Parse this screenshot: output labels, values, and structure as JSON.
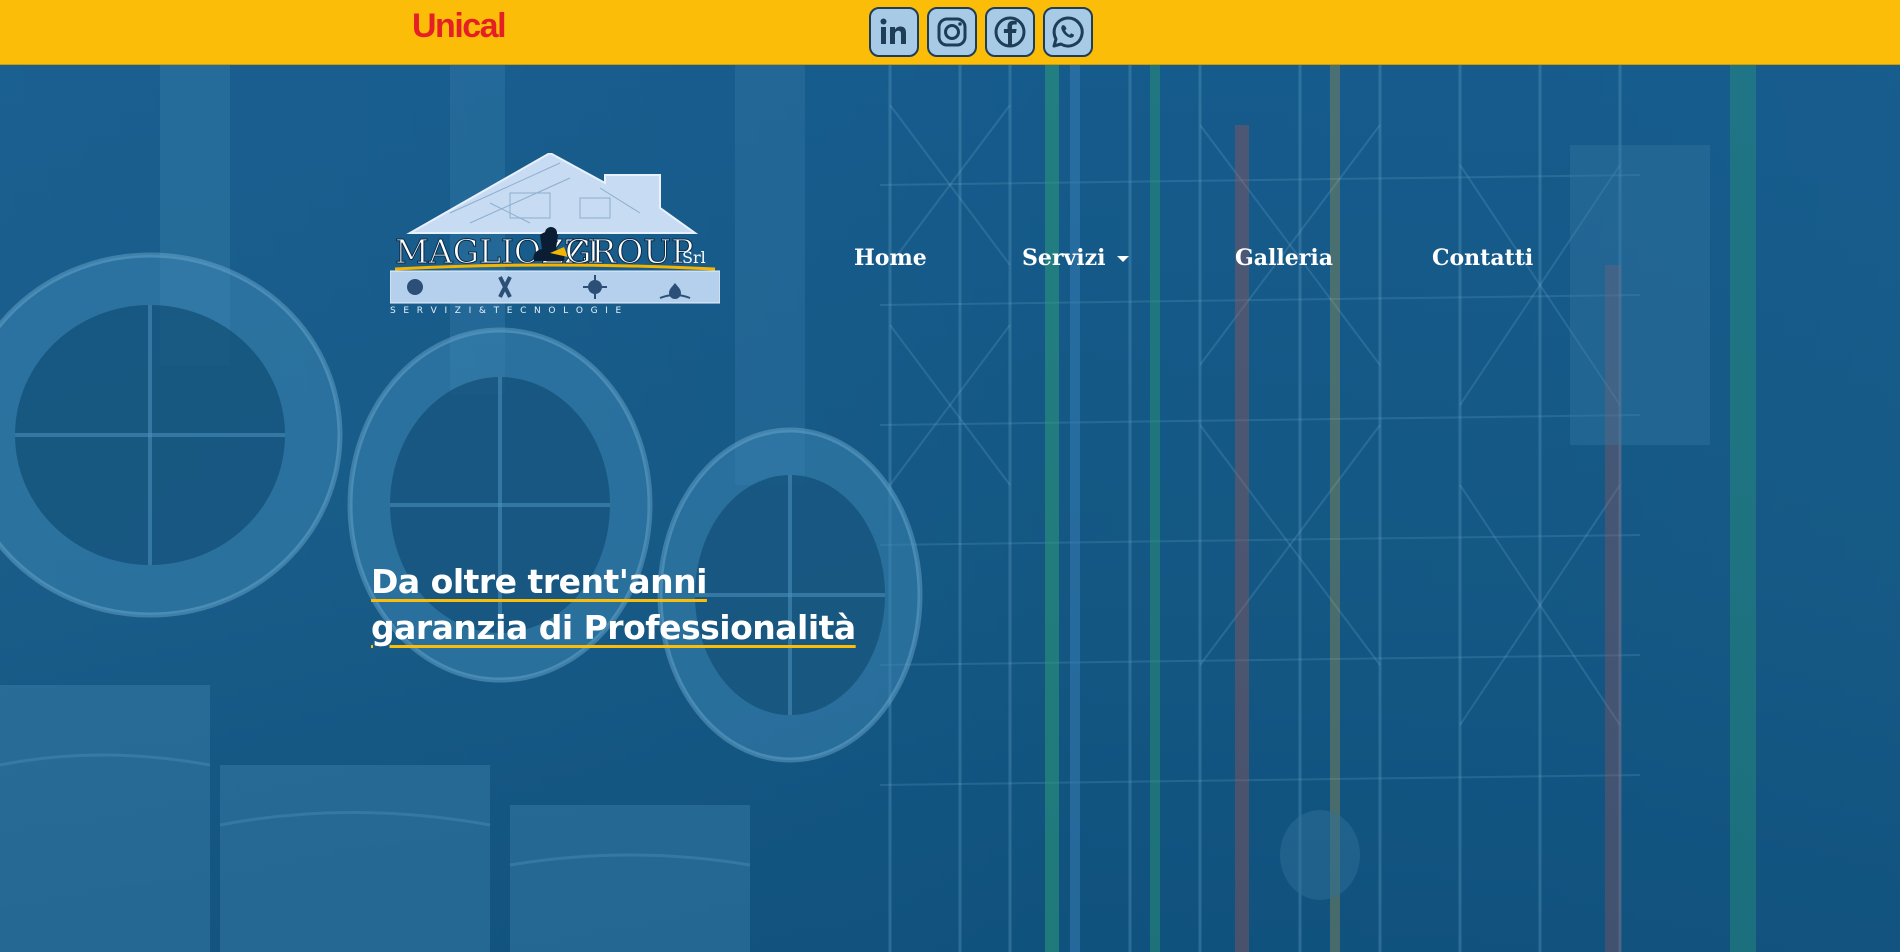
{
  "topbar": {
    "brand": "Unical",
    "social": [
      {
        "icon": "linkedin-icon",
        "label": "in"
      },
      {
        "icon": "instagram-icon"
      },
      {
        "icon": "facebook-icon"
      },
      {
        "icon": "whatsapp-icon"
      }
    ],
    "colors": {
      "bar": "#fbbd08",
      "brand": "#e42026",
      "icon_bg": "#a7cbe6"
    }
  },
  "logo": {
    "name_part1": "MAGLIOZZI",
    "name_part2": "GROUP",
    "suffix": "Srl",
    "tagline": "S E R V I Z I   &   T E C N O L O G I E"
  },
  "nav": {
    "home": "Home",
    "servizi": "Servizi",
    "galleria": "Galleria",
    "contatti": "Contatti"
  },
  "hero": {
    "line1": "Da oltre trent'anni",
    "line2": "garanzia di Professionalità",
    "accent": "#fbbd08"
  }
}
